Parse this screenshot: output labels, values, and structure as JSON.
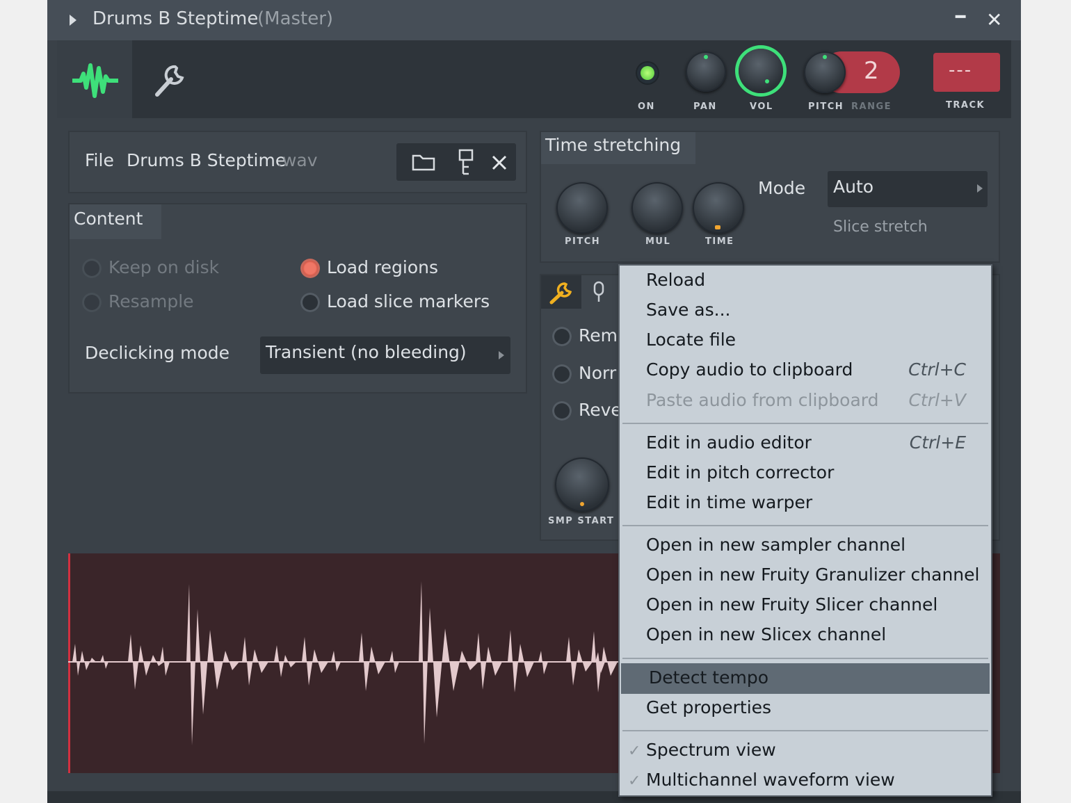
{
  "window": {
    "title": "Drums B Steptime",
    "title_suffix": "(Master)",
    "minimize_label": "━",
    "close_label": "✕"
  },
  "toolbar": {
    "on_label": "ON",
    "pan_label": "PAN",
    "vol_label": "VOL",
    "pitch_label": "PITCH",
    "range_label": "RANGE",
    "range_value": "2",
    "track_label": "TRACK",
    "track_value": "---"
  },
  "file": {
    "label": "File",
    "name": "Drums B Steptime",
    "ext": ".wav"
  },
  "content": {
    "title": "Content",
    "keep_on_disk": "Keep on disk",
    "resample": "Resample",
    "load_regions": "Load regions",
    "load_slice_markers": "Load slice markers",
    "declicking_label": "Declicking mode",
    "declicking_value": "Transient (no bleeding)"
  },
  "time_stretching": {
    "title": "Time stretching",
    "pitch_label": "PITCH",
    "mul_label": "MUL",
    "time_label": "TIME",
    "mode_label": "Mode",
    "mode_value": "Auto",
    "slice_stretch": "Slice stretch"
  },
  "lower_panel": {
    "opt1": "Rem",
    "opt2": "Norr",
    "opt3": "Reve",
    "smp_start": "SMP START"
  },
  "menu": {
    "reload": "Reload",
    "save_as": "Save as...",
    "locate_file": "Locate file",
    "copy_audio": "Copy audio to clipboard",
    "copy_shortcut": "Ctrl+C",
    "paste_audio": "Paste audio from clipboard",
    "paste_shortcut": "Ctrl+V",
    "edit_audio": "Edit in audio editor",
    "edit_audio_shortcut": "Ctrl+E",
    "edit_pitch": "Edit in pitch corrector",
    "edit_time": "Edit in time warper",
    "open_sampler": "Open in new sampler channel",
    "open_granulizer": "Open in new Fruity Granulizer channel",
    "open_slicer": "Open in new Fruity Slicer channel",
    "open_slicex": "Open in new Slicex channel",
    "detect_tempo": "Detect tempo",
    "get_properties": "Get properties",
    "spectrum_view": "Spectrum view",
    "multichannel_view": "Multichannel waveform view",
    "check_mark": "✓"
  },
  "colors": {
    "accent_green": "#3ee07a",
    "track_red": "#b23a48",
    "waveform_bg": "#3a2529",
    "waveform": "#e3c9cc"
  }
}
